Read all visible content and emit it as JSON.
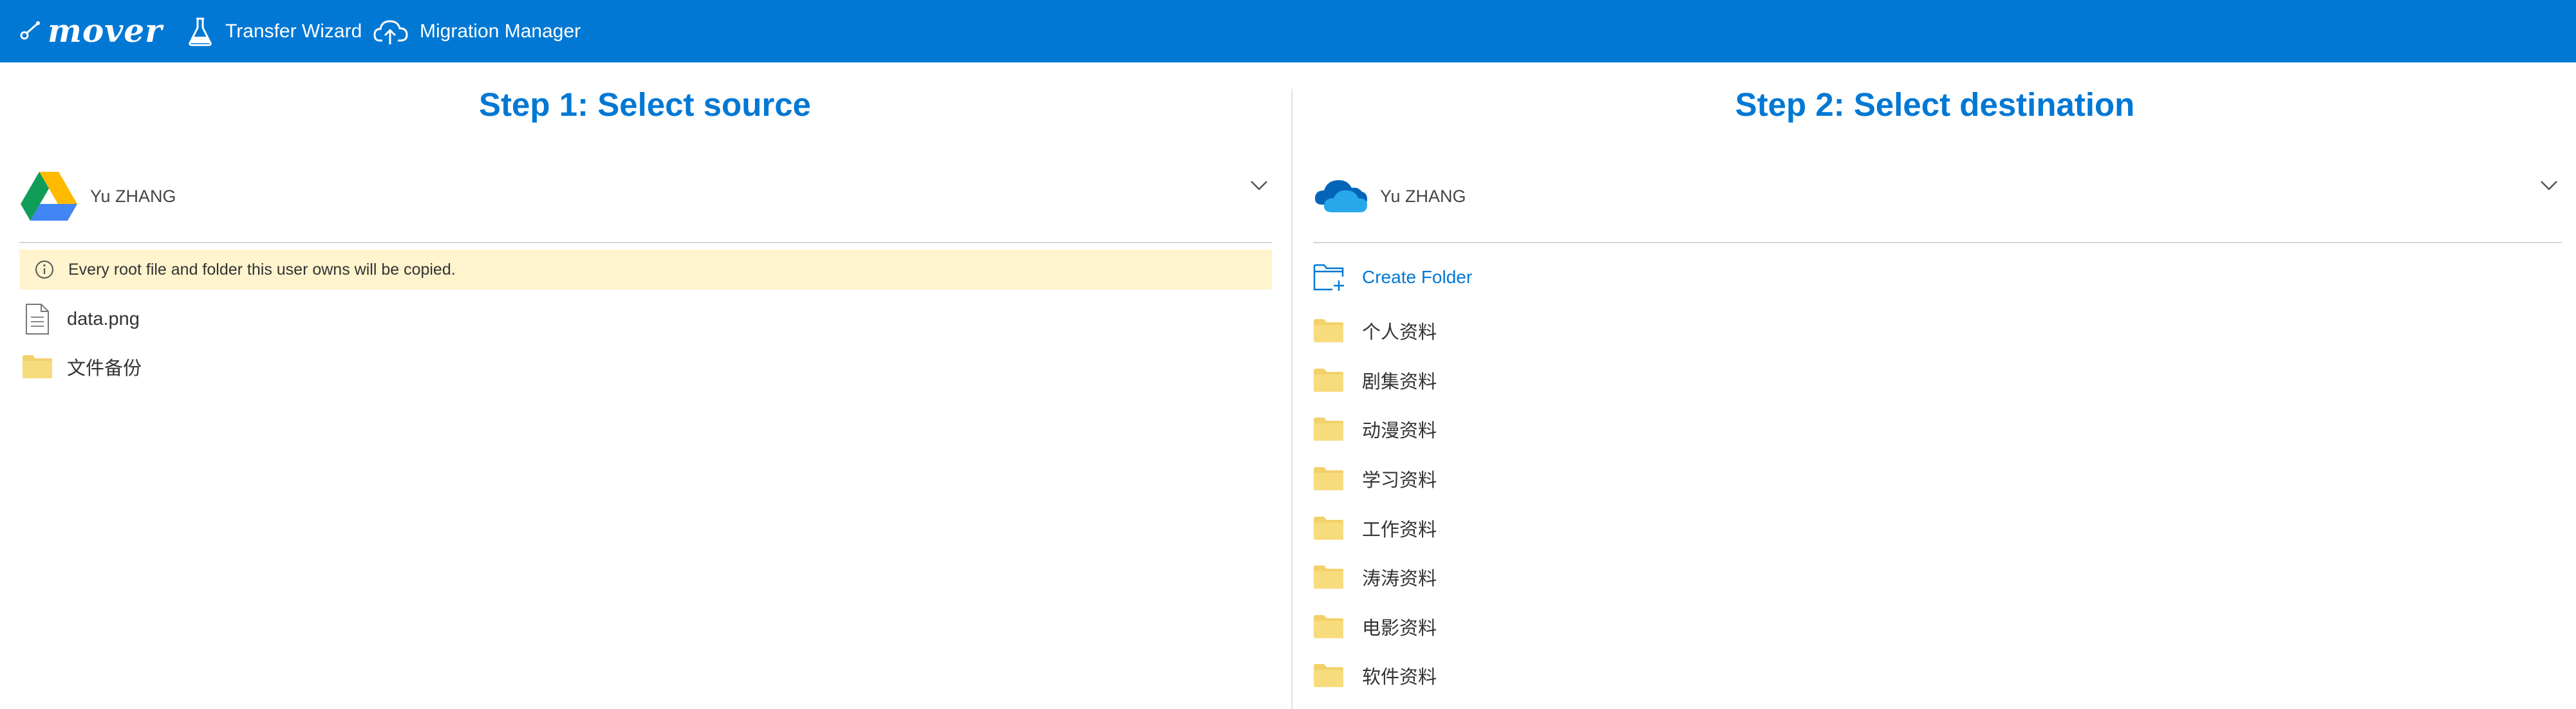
{
  "nav": {
    "logo": "mover",
    "items": [
      {
        "label": "Transfer Wizard",
        "icon": "flask-icon"
      },
      {
        "label": "Migration Manager",
        "icon": "cloud-upload-icon"
      }
    ]
  },
  "source": {
    "title": "Step 1: Select source",
    "account": {
      "name": "Yu ZHANG",
      "icon": "google-drive-icon"
    },
    "notice": "Every root file and folder this user owns will be copied.",
    "items": [
      {
        "name": "data.png",
        "type": "file"
      },
      {
        "name": "文件备份",
        "type": "folder"
      }
    ]
  },
  "destination": {
    "title": "Step 2: Select destination",
    "account": {
      "name": "Yu ZHANG",
      "icon": "onedrive-icon"
    },
    "create_folder": "Create Folder",
    "folders": [
      "个人资料",
      "剧集资料",
      "动漫资料",
      "学习资料",
      "工作资料",
      "涛涛资料",
      "电影资料",
      "软件资料"
    ]
  },
  "colors": {
    "brand": "#0078d4",
    "notice_bg": "#fff4ce",
    "folder": "#f2d16b"
  }
}
